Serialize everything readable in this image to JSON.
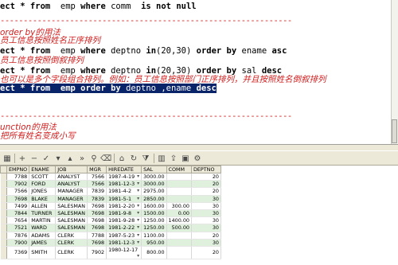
{
  "editor": {
    "lines": [
      {
        "type": "code",
        "text": "ect * from  emp where comm  is not null"
      },
      {
        "type": "sep",
        "text": "---------------------------------------------------------------"
      },
      {
        "type": "comment",
        "text": "order by的用法"
      },
      {
        "type": "comment",
        "text": "员工信息按照姓名正序排列"
      },
      {
        "type": "code",
        "text": "ect * from  emp where deptno in(20,30) order by ename asc"
      },
      {
        "type": "comment",
        "text": "员工信息按照倒叙排列"
      },
      {
        "type": "code",
        "text": "ect * from  emp where deptno in(20,30) order by sal desc"
      },
      {
        "type": "comment",
        "text": "也可以是多个字段组合排列。例如：员工信息按照部门正序排列，并且按照姓名倒叙排列"
      },
      {
        "type": "code-hl",
        "text": "ect * from  emp order by deptno ,ename desc"
      },
      {
        "type": "sep",
        "text": "---------------------------------------------------------------"
      },
      {
        "type": "comment",
        "text": "unction的用法"
      },
      {
        "type": "comment",
        "text": "把所有姓名变成小写"
      }
    ]
  },
  "toolbar": {
    "icons": [
      "grid-icon",
      "insert-row-icon",
      "delete-row-icon",
      "post-icon",
      "arrow-down-icon",
      "arrow-up-icon",
      "arrow-last-icon",
      "find-icon",
      "clear-icon",
      "sql-icon",
      "refresh-icon",
      "filter-icon",
      "chart-icon",
      "export-icon",
      "save-icon",
      "print-icon",
      "tools-icon"
    ]
  },
  "grid": {
    "columns": [
      "EMPNO",
      "ENAME",
      "JOB",
      "MGR",
      "HIREDATE",
      "SAL",
      "COMM",
      "DEPTNO"
    ],
    "rows": [
      [
        "7788",
        "SCOTT",
        "ANALYST",
        "7566",
        "1987-4-19",
        "3000.00",
        "",
        "20"
      ],
      [
        "7902",
        "FORD",
        "ANALYST",
        "7566",
        "1981-12-3",
        "3000.00",
        "",
        "20"
      ],
      [
        "7566",
        "JONES",
        "MANAGER",
        "7839",
        "1981-4-2",
        "2975.00",
        "",
        "20"
      ],
      [
        "7698",
        "BLAKE",
        "MANAGER",
        "7839",
        "1981-5-1",
        "2850.00",
        "",
        "30"
      ],
      [
        "7499",
        "ALLEN",
        "SALESMAN",
        "7698",
        "1981-2-20",
        "1600.00",
        "300.00",
        "30"
      ],
      [
        "7844",
        "TURNER",
        "SALESMAN",
        "7698",
        "1981-9-8",
        "1500.00",
        "0.00",
        "30"
      ],
      [
        "7654",
        "MARTIN",
        "SALESMAN",
        "7698",
        "1981-9-28",
        "1250.00",
        "1400.00",
        "30"
      ],
      [
        "7521",
        "WARD",
        "SALESMAN",
        "7698",
        "1981-2-22",
        "1250.00",
        "500.00",
        "30"
      ],
      [
        "7876",
        "ADAMS",
        "CLERK",
        "7788",
        "1987-5-23",
        "1100.00",
        "",
        "20"
      ],
      [
        "7900",
        "JAMES",
        "CLERK",
        "7698",
        "1981-12-3",
        "950.00",
        "",
        "30"
      ],
      [
        "7369",
        "SMITH",
        "CLERK",
        "7902",
        "1980-12-17",
        "800.00",
        "",
        "20"
      ]
    ]
  },
  "colors": {
    "comment": "#d21e1e",
    "selection": "#0a246a",
    "alt_row": "#dff0dd",
    "chrome": "#ece9d8"
  }
}
